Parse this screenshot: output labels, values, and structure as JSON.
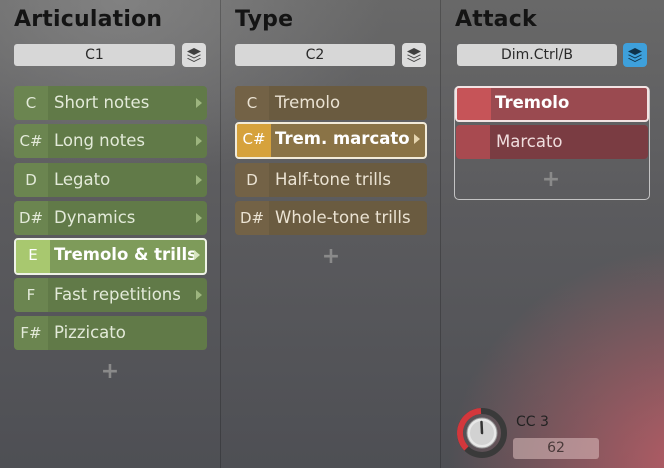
{
  "articulation": {
    "title": "Articulation",
    "control": "C1",
    "items": [
      {
        "key": "C",
        "label": "Short notes",
        "arrow": true
      },
      {
        "key": "C#",
        "label": "Long notes",
        "arrow": true
      },
      {
        "key": "D",
        "label": "Legato",
        "arrow": true
      },
      {
        "key": "D#",
        "label": "Dynamics",
        "arrow": true
      },
      {
        "key": "E",
        "label": "Tremolo & trills",
        "arrow": true
      },
      {
        "key": "F",
        "label": "Fast repetitions",
        "arrow": true
      },
      {
        "key": "F#",
        "label": "Pizzicato",
        "arrow": false
      }
    ],
    "selected": "Tremolo & trills",
    "add": "+"
  },
  "type": {
    "title": "Type",
    "control": "C2",
    "items": [
      {
        "key": "C",
        "label": "Tremolo",
        "arrow": false
      },
      {
        "key": "C#",
        "label": "Trem. marcato",
        "arrow": true
      },
      {
        "key": "D",
        "label": "Half-tone trills",
        "arrow": false
      },
      {
        "key": "D#",
        "label": "Whole-tone trills",
        "arrow": false
      }
    ],
    "selected": "Trem. marcato",
    "add": "+"
  },
  "attack": {
    "title": "Attack",
    "control": "Dim.Ctrl/B",
    "items": [
      {
        "label": "Tremolo"
      },
      {
        "label": "Marcato"
      }
    ],
    "selected": "Tremolo",
    "add": "+"
  },
  "cc": {
    "label": "CC 3",
    "value": "62",
    "level": 0.49
  },
  "colors": {
    "articulation": "#617a48",
    "articulation_selected_key": "#a8c86f",
    "type": "#6a5b40",
    "type_selected_key": "#d6a23c",
    "attack": "#7a3c42",
    "attack_accent": "#c65458",
    "layers_active": "#3ea0dc"
  },
  "icons": {
    "layers": "layers-icon",
    "arrow": "chevron-right-icon",
    "add": "plus-icon",
    "knob": "knob-icon"
  }
}
